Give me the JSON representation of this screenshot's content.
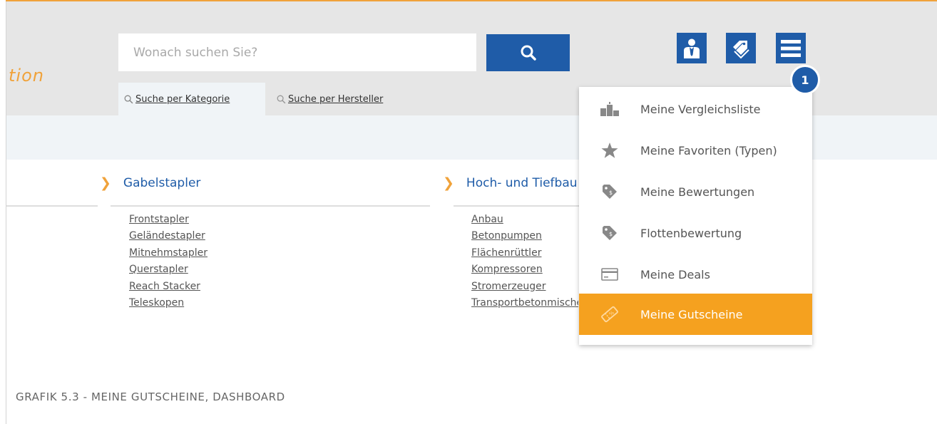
{
  "brand": {
    "text": "tion"
  },
  "search": {
    "placeholder": "Wonach suchen Sie?",
    "button": "search-icon"
  },
  "tabs": [
    {
      "label": "Suche per Kategorie",
      "icon": "search-icon"
    },
    {
      "label": "Suche per Hersteller",
      "icon": "search-icon"
    }
  ],
  "header_icons": [
    "user-icon",
    "tag-icon",
    "menu-icon"
  ],
  "badge": {
    "text": "1"
  },
  "categories": [
    {
      "title": "Gabelstapler",
      "links": [
        "Frontstapler",
        "Geländestapler",
        "Mitnehmstapler",
        "Querstapler",
        "Reach Stacker",
        "Teleskopen"
      ]
    },
    {
      "title": "Hoch- und Tiefbau",
      "links": [
        "Anbau",
        "Betonpumpen",
        "Flächenrüttler",
        "Kompressoren",
        "Stromerzeuger",
        "Transportbetonmischer"
      ]
    }
  ],
  "dropdown": {
    "items": [
      {
        "label": "Meine Vergleichsliste",
        "icon": "podium-icon",
        "active": false
      },
      {
        "label": "Meine Favoriten (Typen)",
        "icon": "star-icon",
        "active": false
      },
      {
        "label": "Meine Bewertungen",
        "icon": "price-tag-icon",
        "active": false
      },
      {
        "label": "Flottenbewertung",
        "icon": "price-tag-icon",
        "active": false
      },
      {
        "label": "Meine Deals",
        "icon": "card-icon",
        "active": false
      },
      {
        "label": "Meine Gutscheine",
        "icon": "voucher-icon",
        "active": true
      }
    ]
  },
  "caption": "GRAFIK 5.3 - MEINE GUTSCHEINE, DASHBOARD",
  "colors": {
    "accent": "#f0a23a",
    "primary": "#1f5ca8",
    "active_item": "#f5a11f",
    "header_bg": "#e6e6e6",
    "band_bg": "#f0f4f7"
  }
}
